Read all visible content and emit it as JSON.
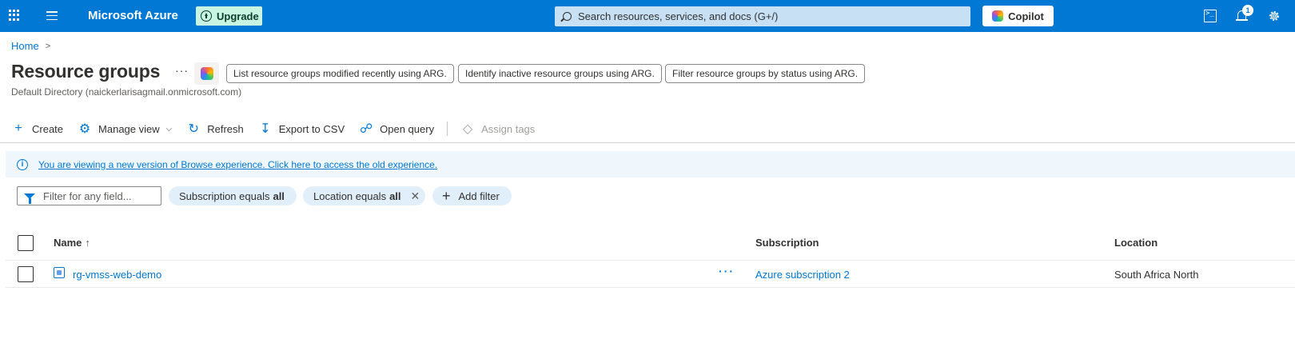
{
  "topbar": {
    "brand": "Microsoft Azure",
    "upgrade_label": "Upgrade",
    "search_placeholder": "Search resources, services, and docs (G+/)",
    "copilot_label": "Copilot",
    "notification_count": "1",
    "icons": [
      "waffle-icon",
      "hamburger-icon",
      "upload-arrow-icon",
      "search-icon",
      "copilot-icon",
      "terminal-icon",
      "bell-icon",
      "gear-icon"
    ]
  },
  "breadcrumb": {
    "home": "Home",
    "separator": ">"
  },
  "page": {
    "title": "Resource groups",
    "more": "···",
    "subtitle": "Default Directory (naickerlarisagmail.onmicrosoft.com)",
    "suggestions": [
      "List resource groups modified recently using ARG.",
      "Identify inactive resource groups using ARG.",
      "Filter resource groups by status using ARG."
    ]
  },
  "toolbar": {
    "create": "Create",
    "manage_view": "Manage view",
    "refresh": "Refresh",
    "export": "Export to CSV",
    "open_query": "Open query",
    "assign_tags": "Assign tags"
  },
  "banner": {
    "text": "You are viewing a new version of Browse experience. Click here to access the old experience."
  },
  "filters": {
    "placeholder": "Filter for any field...",
    "subscription_key": "Subscription equals",
    "subscription_value": "all",
    "location_key": "Location equals",
    "location_value": "all",
    "add_filter": "Add filter"
  },
  "table": {
    "columns": {
      "name": "Name",
      "sort": "↑",
      "subscription": "Subscription",
      "location": "Location"
    },
    "rows": [
      {
        "name": "rg-vmss-web-demo",
        "actions": "···",
        "subscription": "Azure subscription 2",
        "location": "South Africa North"
      }
    ]
  },
  "colors": {
    "accent": "#0078d4",
    "banner": "#eff6fc",
    "pill": "#e1effa",
    "upgrade": "#c7f5e2"
  }
}
